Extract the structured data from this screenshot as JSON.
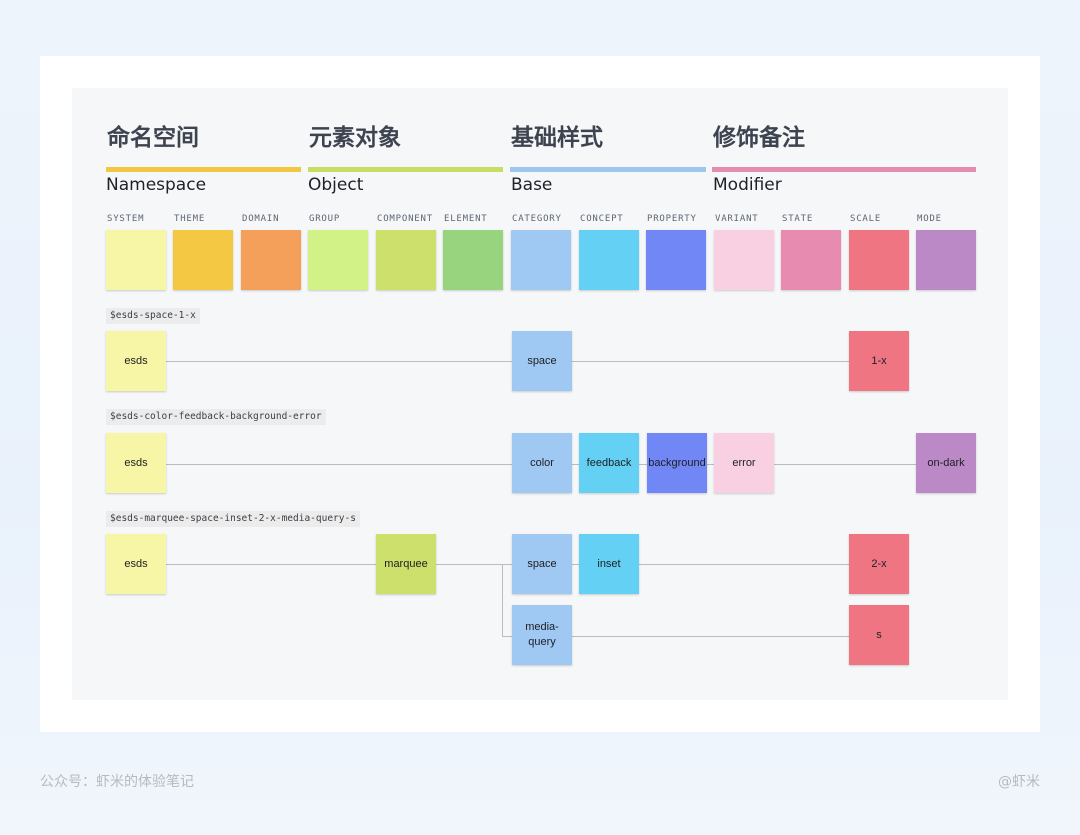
{
  "groups": [
    {
      "cn": "命名空间",
      "en": "Namespace",
      "color": "#f2c744"
    },
    {
      "cn": "元素对象",
      "en": "Object",
      "color": "#c6de62"
    },
    {
      "cn": "基础样式",
      "en": "Base",
      "color": "#9ec6ef"
    },
    {
      "cn": "修饰备注",
      "en": "Modifier",
      "color": "#e68cb0"
    }
  ],
  "columns": [
    {
      "label": "SYSTEM",
      "color": "#f6f6a6"
    },
    {
      "label": "THEME",
      "color": "#f4c842"
    },
    {
      "label": "DOMAIN",
      "color": "#f5a05a"
    },
    {
      "label": "GROUP",
      "color": "#d2f187"
    },
    {
      "label": "COMPONENT",
      "color": "#cde06b"
    },
    {
      "label": "ELEMENT",
      "color": "#98d47e"
    },
    {
      "label": "CATEGORY",
      "color": "#9fc8f2"
    },
    {
      "label": "CONCEPT",
      "color": "#64d0f4"
    },
    {
      "label": "PROPERTY",
      "color": "#7187f6"
    },
    {
      "label": "VARIANT",
      "color": "#f8d0e2"
    },
    {
      "label": "STATE",
      "color": "#e88bb1"
    },
    {
      "label": "SCALE",
      "color": "#f07583"
    },
    {
      "label": "MODE",
      "color": "#bb89c6"
    }
  ],
  "examples": [
    {
      "token": "$esds-space-1-x",
      "boxes": [
        "esds",
        "space",
        "1-x"
      ]
    },
    {
      "token": "$esds-color-feedback-background-error",
      "boxes": [
        "esds",
        "color",
        "feedback",
        "background",
        "error",
        "on-dark"
      ]
    },
    {
      "token": "$esds-marquee-space-inset-2-x-media-query-s",
      "boxes": [
        "esds",
        "marquee",
        "space",
        "inset",
        "2-x",
        "media-\nquery",
        "s"
      ]
    }
  ],
  "footer": {
    "left": "公众号：虾米的体验笔记",
    "right": "@虾米"
  }
}
